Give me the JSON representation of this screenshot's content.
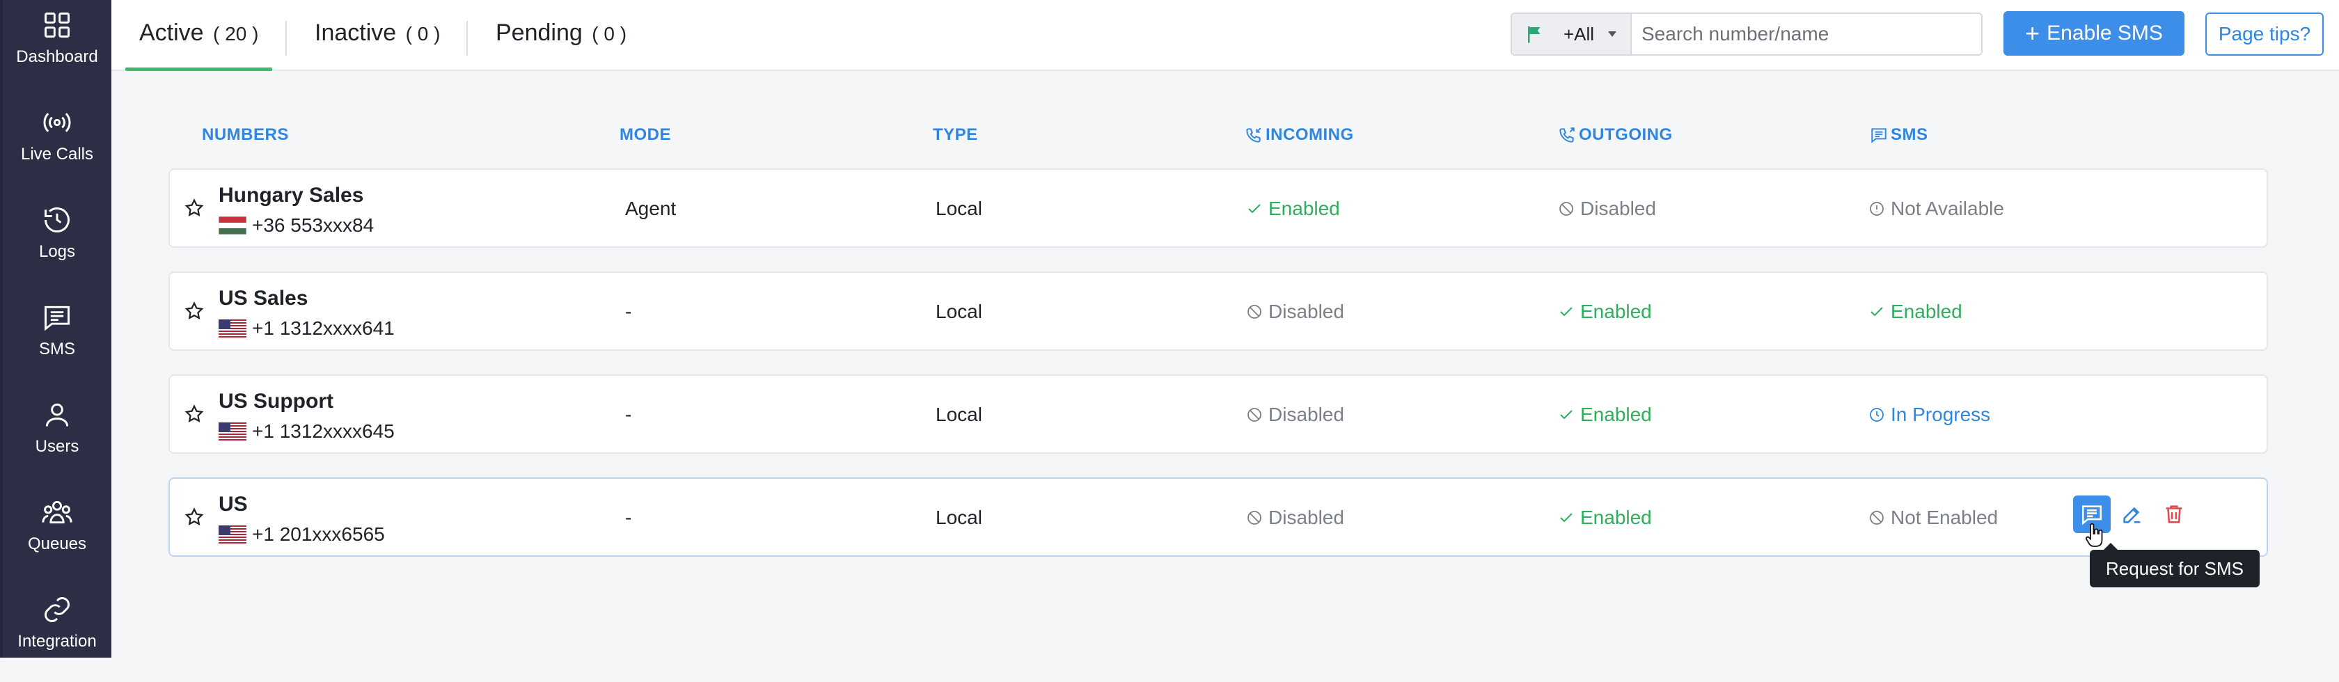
{
  "sidebar": {
    "items": [
      {
        "label": "Dashboard",
        "icon": "grid-icon"
      },
      {
        "label": "Live Calls",
        "icon": "broadcast-icon"
      },
      {
        "label": "Logs",
        "icon": "history-icon"
      },
      {
        "label": "SMS",
        "icon": "message-icon"
      },
      {
        "label": "Users",
        "icon": "user-icon"
      },
      {
        "label": "Queues",
        "icon": "group-icon"
      },
      {
        "label": "Integration",
        "icon": "link-icon"
      }
    ]
  },
  "tabs": [
    {
      "label": "Active",
      "count": "( 20 )",
      "active": true
    },
    {
      "label": "Inactive",
      "count": "( 0 )",
      "active": false
    },
    {
      "label": "Pending",
      "count": "( 0 )",
      "active": false
    }
  ],
  "filter": {
    "country_value": "+All",
    "search_placeholder": "Search number/name"
  },
  "buttons": {
    "enable_sms": "Enable SMS",
    "page_tips": "Page tips?"
  },
  "table": {
    "columns": [
      "NUMBERS",
      "MODE",
      "TYPE",
      "INCOMING",
      "OUTGOING",
      "SMS"
    ],
    "rows": [
      {
        "name": "Hungary Sales",
        "number": "+36 553xxx84",
        "flag": "hungary",
        "mode": "Agent",
        "type": "Local",
        "incoming": "Enabled",
        "outgoing": "Disabled",
        "sms": "Not Available"
      },
      {
        "name": "US Sales",
        "number": "+1 1312xxxx641",
        "flag": "us",
        "mode": "-",
        "type": "Local",
        "incoming": "Disabled",
        "outgoing": "Enabled",
        "sms": "Enabled"
      },
      {
        "name": "US Support",
        "number": "+1 1312xxxx645",
        "flag": "us",
        "mode": "-",
        "type": "Local",
        "incoming": "Disabled",
        "outgoing": "Enabled",
        "sms": "In Progress"
      },
      {
        "name": "US",
        "number": "+1 201xxx6565",
        "flag": "us",
        "mode": "-",
        "type": "Local",
        "incoming": "Disabled",
        "outgoing": "Enabled",
        "sms": "Not Enabled"
      }
    ]
  },
  "tooltip": "Request for SMS",
  "colors": {
    "sidebar_bg": "#2b2e45",
    "accent_blue": "#3d8ee8",
    "enabled_green": "#2fae5c",
    "disabled_gray": "#7b8088",
    "delete_red": "#e5484d",
    "tab_underline": "#3fb86b"
  }
}
